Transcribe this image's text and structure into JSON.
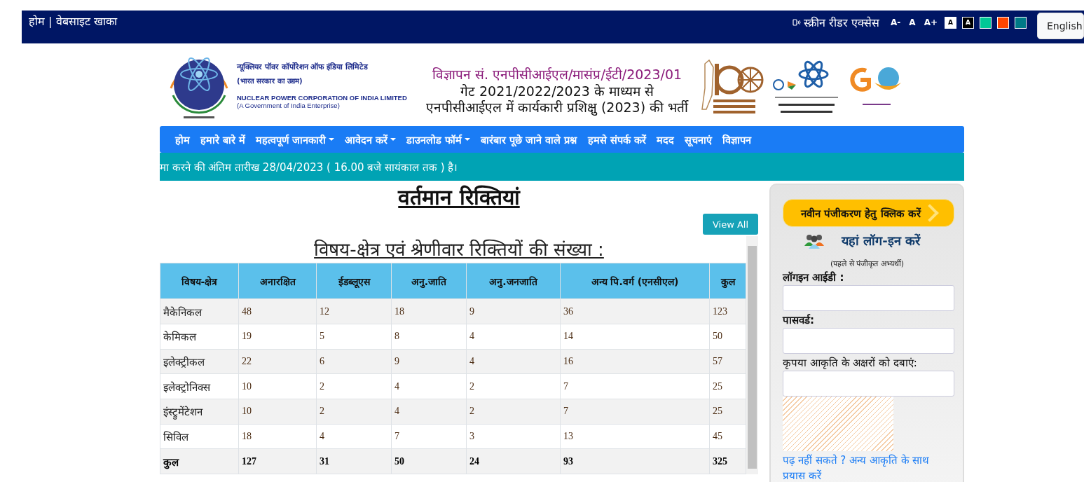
{
  "top_bar": {
    "home_link": "होम | वेबसाइट खाका",
    "screen_reader": "स्क्रीन रीडर एक्सेस",
    "font_sizes": [
      "A-",
      "A",
      "A+"
    ],
    "themes": [
      {
        "kind": "text",
        "label": "A",
        "color": "#ffffff"
      },
      {
        "kind": "text",
        "label": "A",
        "color": "#000000"
      },
      {
        "kind": "swatch",
        "color": "#00c896"
      },
      {
        "kind": "swatch",
        "color": "#ff4500"
      },
      {
        "kind": "swatch",
        "color": "#007a87"
      }
    ],
    "language": "English"
  },
  "header": {
    "org_hindi": "न्यूक्लियर पॉवर कॉर्पोरेशन ऑफ इंडिया लिमिटेड",
    "org_hindi_sub": "(भारत सरकार का उद्यम)",
    "org_english": "NUCLEAR POWER CORPORATION OF INDIA LIMITED",
    "org_english_sub": "(A Government of India Enterprise)",
    "advert_no": "विज्ञापन सं. एनपीसीआईएल/मासंप्र/ईटी/2023/01",
    "title_lines": [
      "गेट 2021/2022/2023 के माध्यम से",
      "एनपीसीआईएल में कार्यकारी प्रशिक्षु (2023) की भर्ती"
    ]
  },
  "nav": [
    {
      "label": "होम",
      "dropdown": false
    },
    {
      "label": "हमारे बारे में",
      "dropdown": false
    },
    {
      "label": "महत्वपूर्ण जानकारी",
      "dropdown": true
    },
    {
      "label": "आवेदन करें",
      "dropdown": true
    },
    {
      "label": "डाउनलोड फॉर्म",
      "dropdown": true
    },
    {
      "label": "बारंबार पूछे जाने वाले प्रश्न",
      "dropdown": false
    },
    {
      "label": "हमसे संपर्क करें",
      "dropdown": false
    },
    {
      "label": "मदद",
      "dropdown": false
    },
    {
      "label": "सूचनाएं",
      "dropdown": false
    },
    {
      "label": "विज्ञापन",
      "dropdown": false
    }
  ],
  "ticker": "मा करने की अंतिम तारीख 28/04/2023 ( 16.00 बजे सायंकाल तक ) है।",
  "main": {
    "heading": "वर्तमान रिक्तियां",
    "view_all": "View All",
    "table_title": "विषय-क्षेत्र एवं श्रेणीवार रिक्तियों की संख्या :",
    "table": {
      "columns": [
        "विषय-क्षेत्र",
        "अनारक्षित",
        "ईडब्लूएस",
        "अनु.जाति",
        "अनु.जनजाति",
        "अन्य पि.वर्ग (एनसीएल)",
        "कुल"
      ],
      "rows": [
        {
          "kind": "data",
          "cells": [
            "मैकेनिकल",
            "48",
            "12",
            "18",
            "9",
            "36",
            "123"
          ]
        },
        {
          "kind": "data",
          "cells": [
            "केमिकल",
            "19",
            "5",
            "8",
            "4",
            "14",
            "50"
          ]
        },
        {
          "kind": "data",
          "cells": [
            "इलेक्ट्रीकल",
            "22",
            "6",
            "9",
            "4",
            "16",
            "57"
          ]
        },
        {
          "kind": "data",
          "cells": [
            "इलेक्ट्रोनिक्स",
            "10",
            "2",
            "4",
            "2",
            "7",
            "25"
          ]
        },
        {
          "kind": "data",
          "cells": [
            "इंस्ट्रुमेंटेशन",
            "10",
            "2",
            "4",
            "2",
            "7",
            "25"
          ]
        },
        {
          "kind": "data",
          "cells": [
            "सिविल",
            "18",
            "4",
            "7",
            "3",
            "13",
            "45"
          ]
        },
        {
          "kind": "total",
          "cells": [
            "कुल",
            "127",
            "31",
            "50",
            "24",
            "93",
            "325"
          ]
        }
      ]
    }
  },
  "sidebar": {
    "register_button": "नवीन पंजीकरण हेतु क्लिक करें",
    "login_title": "यहां लॉग-इन करें",
    "login_note": "(पहले से पंजीकृत अभ्यर्थी)",
    "fields": [
      {
        "label": "लॉगइन आईडी :",
        "bold": true
      },
      {
        "label": "पासवर्ड:",
        "bold": true
      },
      {
        "label": "कृपया आकृति के अक्षरों को दबाएं:",
        "bold": false
      }
    ],
    "reload_link": "पढ़ नहीं सकते ? अन्य आकृति के साथ प्रयास करें"
  }
}
